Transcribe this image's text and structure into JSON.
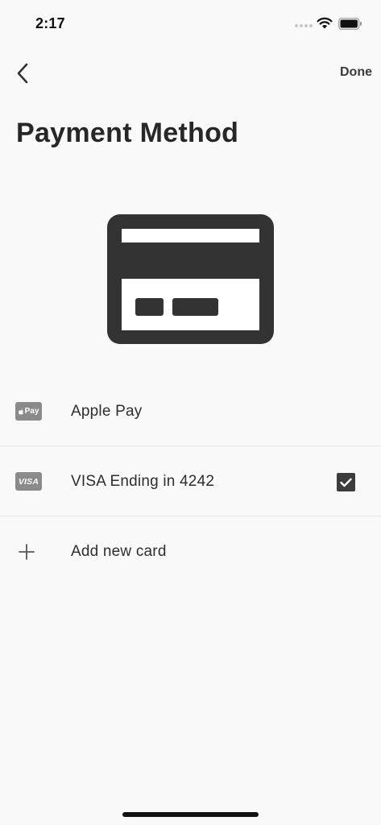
{
  "status_bar": {
    "time": "2:17"
  },
  "nav": {
    "back_icon": "chevron-left-icon",
    "done_label": "Done"
  },
  "page": {
    "title": "Payment Method"
  },
  "hero": {
    "icon": "credit-card-icon"
  },
  "methods": [
    {
      "label": "Apple Pay",
      "badge": "Pay",
      "icon": "apple-pay-icon",
      "selected": false
    },
    {
      "label": "VISA Ending in 4242",
      "badge": "VISA",
      "icon": "visa-icon",
      "selected": true
    },
    {
      "label": "Add new card",
      "icon": "plus-icon",
      "selected": false
    }
  ],
  "colors": {
    "background": "#f9f9f9",
    "icon_dark": "#333333",
    "badge_gray": "#8a8a8a",
    "divider": "#e6e6e6"
  }
}
